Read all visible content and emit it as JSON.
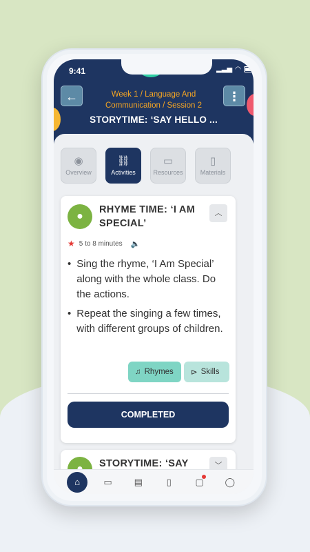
{
  "status_bar": {
    "time": "9:41"
  },
  "header": {
    "breadcrumb_line1": "Week 1 / Language And",
    "breadcrumb_line2": "Communication / Session 2",
    "title": "STORYTIME: ‘SAY HELLO ..."
  },
  "tabs": [
    {
      "label": "Overview",
      "icon": "eye-icon"
    },
    {
      "label": "Activities",
      "icon": "link-icon",
      "active": true
    },
    {
      "label": "Resources",
      "icon": "folder-icon"
    },
    {
      "label": "Materials",
      "icon": "document-icon"
    }
  ],
  "activity_card": {
    "title_line1": "RHYME TIME: ‘I AM",
    "title_line2": "SPECIAL’",
    "duration": "5 to 8 minutes",
    "bullets": [
      "Sing the rhyme, ‘I Am Special’ along with the whole class. Do the actions.",
      "Repeat the singing a few times, with different groups of children."
    ],
    "chips": {
      "rhymes": "Rhymes",
      "skills": "Skills"
    },
    "completed_label": "COMPLETED"
  },
  "second_card": {
    "title_line1": "STORYTIME: ‘SAY"
  },
  "bottom_nav": [
    "home-icon",
    "folder-icon",
    "cards-icon",
    "document-icon",
    "chat-icon",
    "user-icon"
  ],
  "colors": {
    "primary": "#1e3561",
    "accent": "#f6a623",
    "green": "#7cb342",
    "teal": "#7fd5c4"
  }
}
